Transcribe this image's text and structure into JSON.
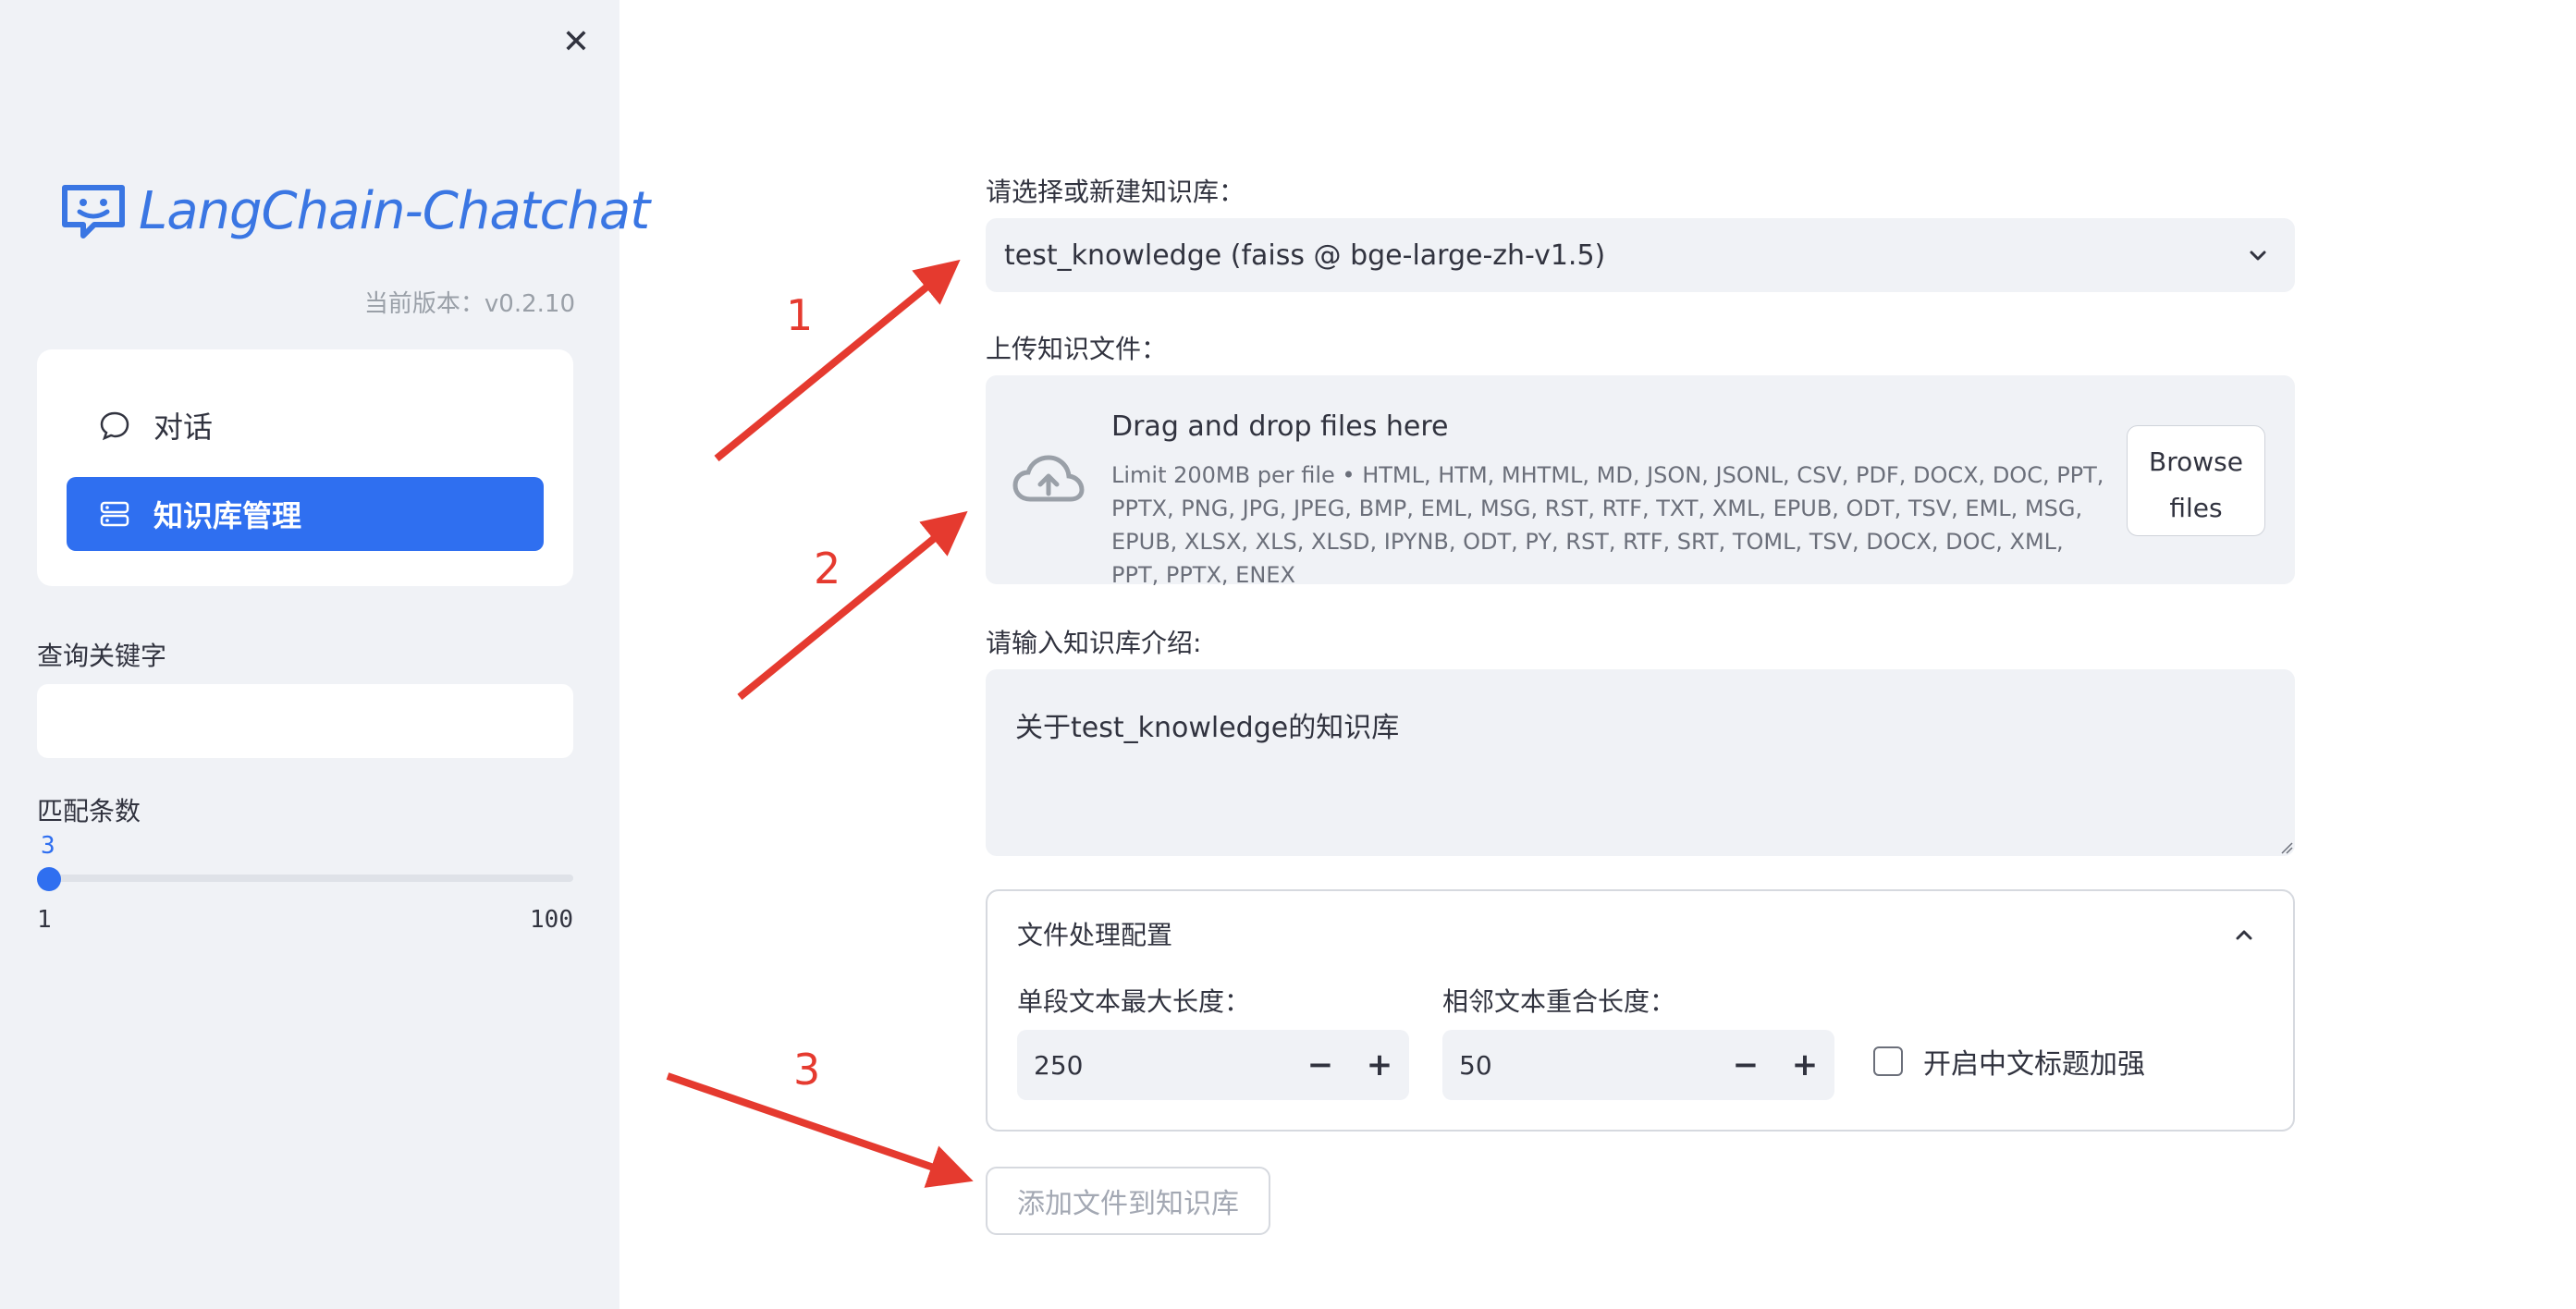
{
  "sidebar": {
    "app_name": "LangChain-Chatchat",
    "version": "当前版本：v0.2.10",
    "nav_items": [
      {
        "label": "对话",
        "icon": "chat-bubble-icon",
        "active": false
      },
      {
        "label": "知识库管理",
        "icon": "database-icon",
        "active": true
      }
    ],
    "search_label": "查询关键字",
    "search_value": "",
    "match_label": "匹配条数",
    "slider": {
      "value": "3",
      "min": "1",
      "max": "100"
    }
  },
  "main": {
    "kb_select_label": "请选择或新建知识库：",
    "kb_selected": "test_knowledge (faiss @ bge-large-zh-v1.5)",
    "upload_label": "上传知识文件：",
    "dropzone_title": "Drag and drop files here",
    "dropzone_limit": "Limit 200MB per file • HTML, HTM, MHTML, MD, JSON, JSONL, CSV, PDF, DOCX, DOC, PPT, PPTX, PNG, JPG, JPEG, BMP, EML, MSG, RST, RTF, TXT, XML, EPUB, ODT, TSV, EML, MSG, EPUB, XLSX, XLS, XLSD, IPYNB, ODT, PY, RST, RTF, SRT, TOML, TSV, DOCX, DOC, XML, PPT, PPTX, ENEX",
    "browse_line1": "Browse",
    "browse_line2": "files",
    "intro_label": "请输入知识库介绍:",
    "intro_value": "关于test_knowledge的知识库",
    "config": {
      "title": "文件处理配置",
      "chunk_size_label": "单段文本最大长度：",
      "chunk_size_value": "250",
      "overlap_label": "相邻文本重合长度：",
      "overlap_value": "50",
      "zh_title_label": "开启中文标题加强",
      "zh_title_checked": false
    },
    "submit_label": "添加文件到知识库"
  },
  "annotations": [
    "1",
    "2",
    "3"
  ],
  "colors": {
    "accent": "#2f6ff0",
    "annotation": "#e53a2f",
    "sidebar_bg": "#f0f2f6"
  }
}
